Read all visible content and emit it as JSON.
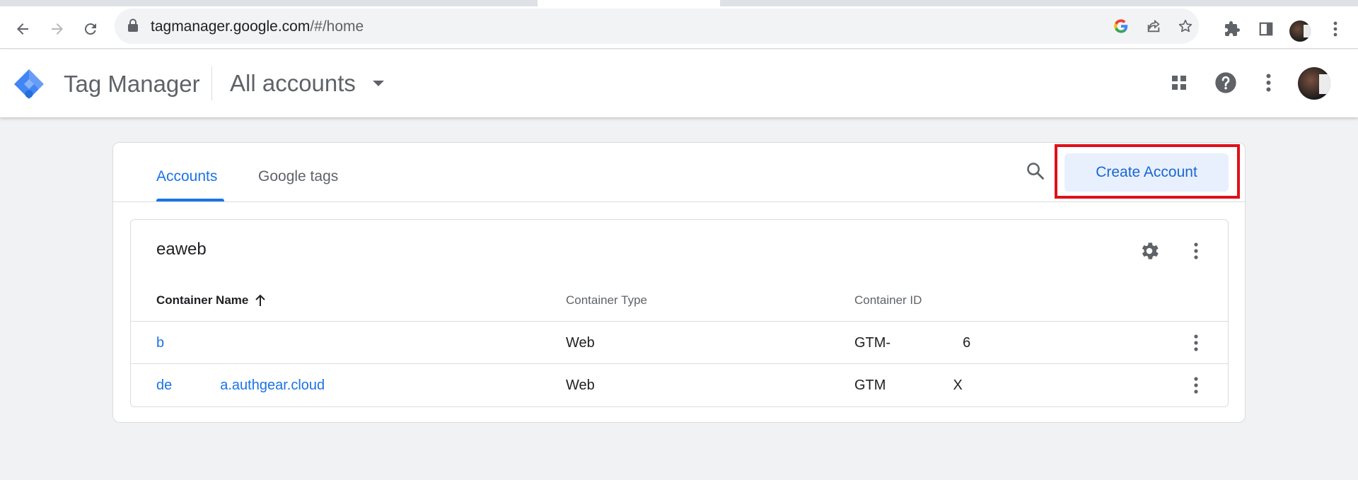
{
  "browser": {
    "url_host": "tagmanager.google.com",
    "url_path": "/#/home",
    "icons": [
      "back-icon",
      "forward-icon",
      "reload-icon",
      "lock-icon",
      "google-icon",
      "share-icon",
      "star-icon",
      "extensions-icon",
      "side-panel-icon",
      "profile-avatar",
      "more-vert-icon"
    ]
  },
  "header": {
    "product_name": "Tag Manager",
    "account_switcher_label": "All accounts",
    "icons": [
      "apps-grid-icon",
      "help-icon",
      "more-vert-icon",
      "account-avatar"
    ]
  },
  "tabs": [
    {
      "label": "Accounts",
      "active": true
    },
    {
      "label": "Google tags",
      "active": false
    }
  ],
  "actions": {
    "create_account_label": "Create Account"
  },
  "account": {
    "name": "eaweb",
    "columns": {
      "name": "Container Name",
      "type": "Container Type",
      "id": "Container ID"
    },
    "rows": [
      {
        "name_start": "b",
        "name_end": "",
        "type": "Web",
        "id_start": "GTM-",
        "id_end": "6"
      },
      {
        "name_start": "de",
        "name_end": "a.authgear.cloud",
        "type": "Web",
        "id_start": "GTM",
        "id_end": "X"
      }
    ]
  },
  "colors": {
    "accent": "#1a73e8",
    "highlight": "#e0101a",
    "button_bg": "#e8f0fe"
  }
}
